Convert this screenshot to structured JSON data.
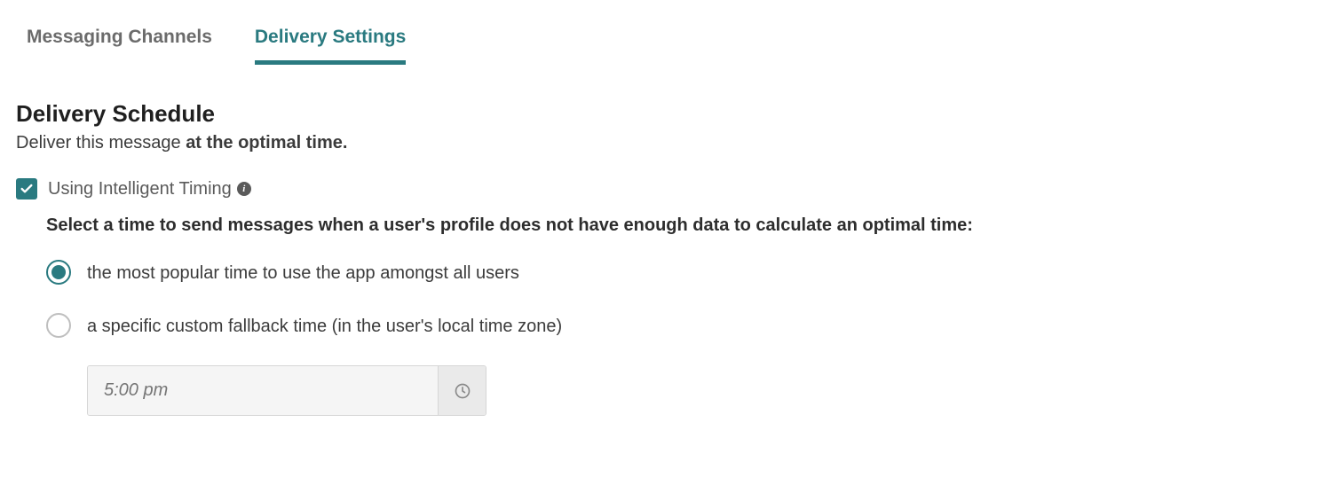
{
  "tabs": {
    "items": [
      {
        "label": "Messaging Channels",
        "active": false
      },
      {
        "label": "Delivery Settings",
        "active": true
      }
    ]
  },
  "section": {
    "title": "Delivery Schedule",
    "subtext_prefix": "Deliver this message ",
    "subtext_bold": "at the optimal time."
  },
  "intelligent_timing": {
    "checked": true,
    "label": "Using Intelligent Timing",
    "prompt": "Select a time to send messages when a user's profile does not have enough data to calculate an optimal time:"
  },
  "fallback": {
    "options": [
      {
        "label": "the most popular time to use the app amongst all users",
        "selected": true
      },
      {
        "label": "a specific custom fallback time (in the user's local time zone)",
        "selected": false
      }
    ],
    "time_placeholder": "5:00 pm"
  }
}
